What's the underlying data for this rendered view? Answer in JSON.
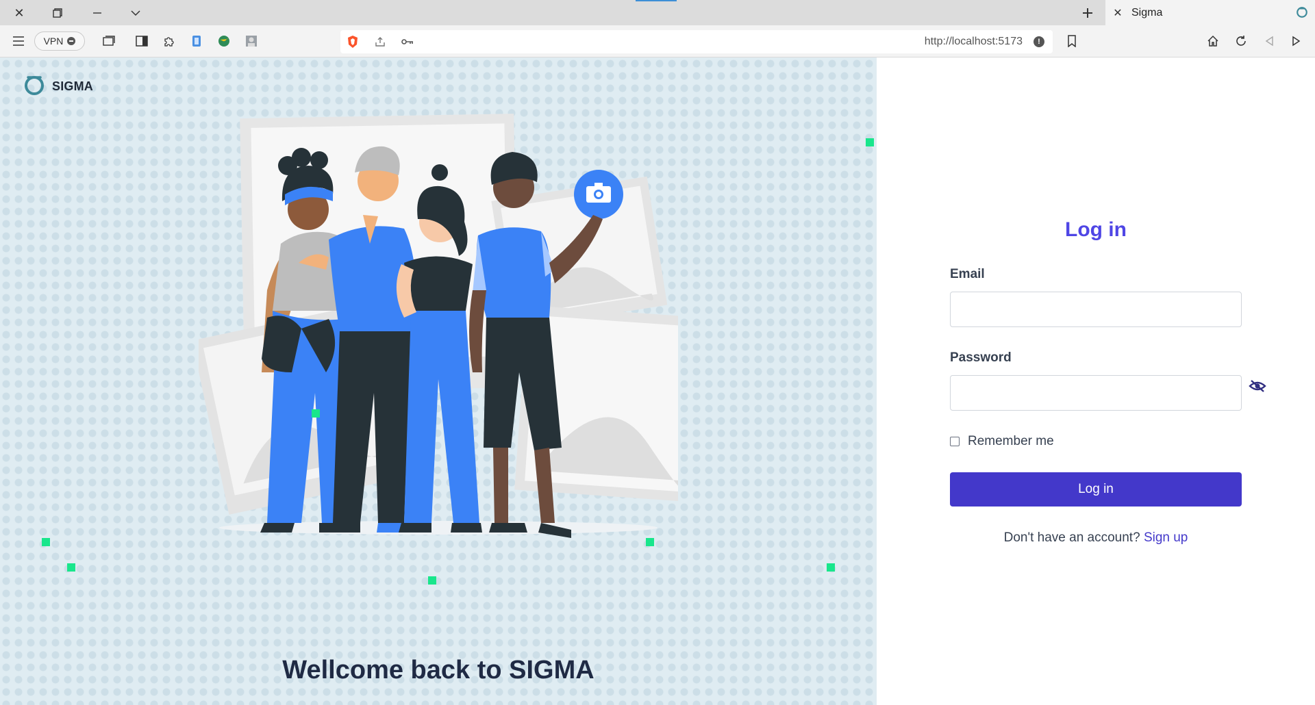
{
  "browser": {
    "tab_title": "Sigma",
    "vpn_label": "VPN",
    "url": "http://localhost:5173"
  },
  "brand": {
    "name": "SIGMA",
    "logo_color": "#3d8a9a"
  },
  "hero": {
    "welcome_text": "Wellcome back to SIGMA"
  },
  "login": {
    "title": "Log in",
    "email_label": "Email",
    "email_value": "",
    "password_label": "Password",
    "password_value": "",
    "remember_label": "Remember me",
    "remember_checked": false,
    "submit_label": "Log in",
    "signup_prompt": "Don't have an account?",
    "signup_link": "Sign up"
  },
  "colors": {
    "accent": "#4338ca",
    "title": "#4f46e5",
    "left_bg": "#dfecf2",
    "highlight_square": "#19e68c"
  },
  "icons": {
    "password_toggle": "eye-slash-icon",
    "camera_badge": "camera-icon"
  }
}
